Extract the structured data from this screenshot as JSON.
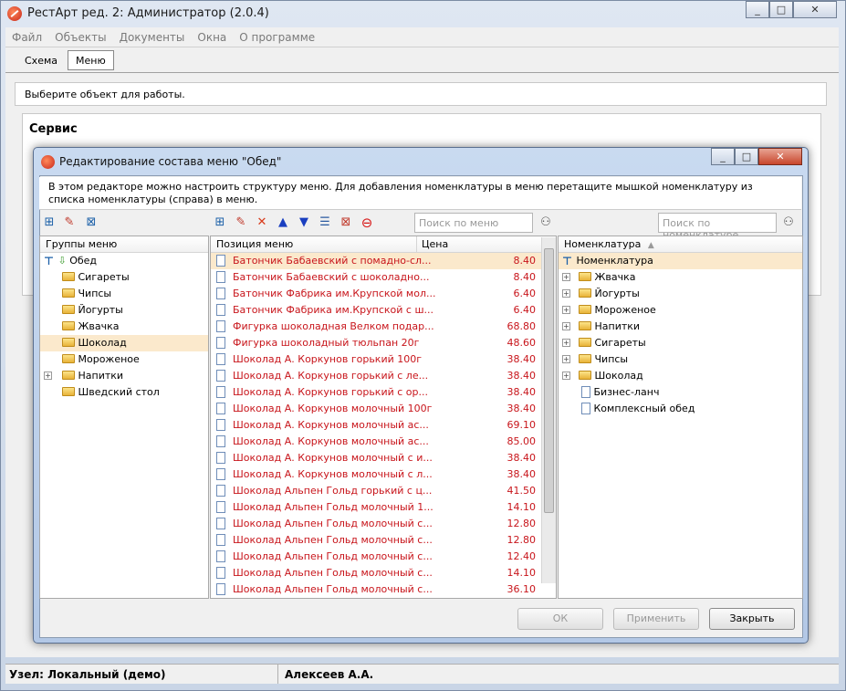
{
  "app": {
    "title": "РестАрт ред. 2: Администратор (2.0.4)",
    "caption_buttons": [
      "_",
      "□",
      "✕"
    ]
  },
  "menubar": [
    "Файл",
    "Объекты",
    "Документы",
    "Окна",
    "О программе"
  ],
  "tabs": [
    {
      "label": "Схема",
      "active": false
    },
    {
      "label": "Меню",
      "active": true
    }
  ],
  "hint": "Выберите объект для работы.",
  "service": {
    "title": "Сервис"
  },
  "statusbar": {
    "node": "Узел: Локальный (демо)",
    "user": "Алексеев А.А."
  },
  "dialog": {
    "title": "Редактирование состава меню \"Обед\"",
    "description": "В этом редакторе можно настроить структуру меню. Для добавления номенклатуры в меню перетащите мышкой номенклатуру из списка номенклатуры (справа) в меню.",
    "search_menu_placeholder": "Поиск по меню",
    "search_nomenclature_placeholder": "Поиск по номенклатуре",
    "groups": {
      "header": "Группы меню",
      "root": "Обед",
      "items": [
        {
          "label": "Сигареты",
          "expandable": false,
          "selected": false
        },
        {
          "label": "Чипсы",
          "expandable": false,
          "selected": false
        },
        {
          "label": "Йогурты",
          "expandable": false,
          "selected": false
        },
        {
          "label": "Жвачка",
          "expandable": false,
          "selected": false
        },
        {
          "label": "Шоколад",
          "expandable": false,
          "selected": true
        },
        {
          "label": "Мороженое",
          "expandable": false,
          "selected": false
        },
        {
          "label": "Напитки",
          "expandable": true,
          "selected": false
        },
        {
          "label": "Шведский стол",
          "expandable": false,
          "selected": false
        }
      ]
    },
    "positions": {
      "header_name": "Позиция меню",
      "header_price": "Цена",
      "rows": [
        {
          "name": "Батончик Бабаевский с помадно-сл...",
          "price": "8.40"
        },
        {
          "name": "Батончик Бабаевский с шоколадно...",
          "price": "8.40"
        },
        {
          "name": "Батончик Фабрика им.Крупской мол...",
          "price": "6.40"
        },
        {
          "name": "Батончик Фабрика им.Крупской с ш...",
          "price": "6.40"
        },
        {
          "name": "Фигурка шоколадная Велком подар...",
          "price": "68.80"
        },
        {
          "name": "Фигурка шоколадный тюльпан 20г",
          "price": "48.60"
        },
        {
          "name": "Шоколад А. Коркунов горький 100г",
          "price": "38.40"
        },
        {
          "name": "Шоколад А. Коркунов горький с ле...",
          "price": "38.40"
        },
        {
          "name": "Шоколад А. Коркунов горький с ор...",
          "price": "38.40"
        },
        {
          "name": "Шоколад А. Коркунов молочный 100г",
          "price": "38.40"
        },
        {
          "name": "Шоколад А. Коркунов молочный ас...",
          "price": "69.10"
        },
        {
          "name": "Шоколад А. Коркунов молочный ас...",
          "price": "85.00"
        },
        {
          "name": "Шоколад А. Коркунов молочный с и...",
          "price": "38.40"
        },
        {
          "name": "Шоколад А. Коркунов молочный с л...",
          "price": "38.40"
        },
        {
          "name": "Шоколад Альпен Гольд горький с ц...",
          "price": "41.50"
        },
        {
          "name": "Шоколад Альпен Гольд молочный 1...",
          "price": "14.10"
        },
        {
          "name": "Шоколад Альпен Гольд молочный с...",
          "price": "12.80"
        },
        {
          "name": "Шоколад Альпен Гольд молочный с...",
          "price": "12.80"
        },
        {
          "name": "Шоколад Альпен Гольд молочный с...",
          "price": "12.40"
        },
        {
          "name": "Шоколад Альпен Гольд молочный с...",
          "price": "14.10"
        },
        {
          "name": "Шоколад Альпен Гольд молочный с...",
          "price": "36.10"
        }
      ]
    },
    "nomenclature": {
      "header": "Номенклатура",
      "root": "Номенклатура",
      "items": [
        {
          "label": "Жвачка",
          "type": "folder"
        },
        {
          "label": "Йогурты",
          "type": "folder"
        },
        {
          "label": "Мороженое",
          "type": "folder"
        },
        {
          "label": "Напитки",
          "type": "folder"
        },
        {
          "label": "Сигареты",
          "type": "folder"
        },
        {
          "label": "Чипсы",
          "type": "folder"
        },
        {
          "label": "Шоколад",
          "type": "folder"
        },
        {
          "label": "Бизнес-ланч",
          "type": "doc"
        },
        {
          "label": "Комплексный обед",
          "type": "doc"
        }
      ]
    },
    "buttons": {
      "ok": "ОК",
      "apply": "Применить",
      "close": "Закрыть"
    }
  },
  "colors": {
    "item_red": "#c8151b",
    "selection": "#fbe9cc"
  }
}
